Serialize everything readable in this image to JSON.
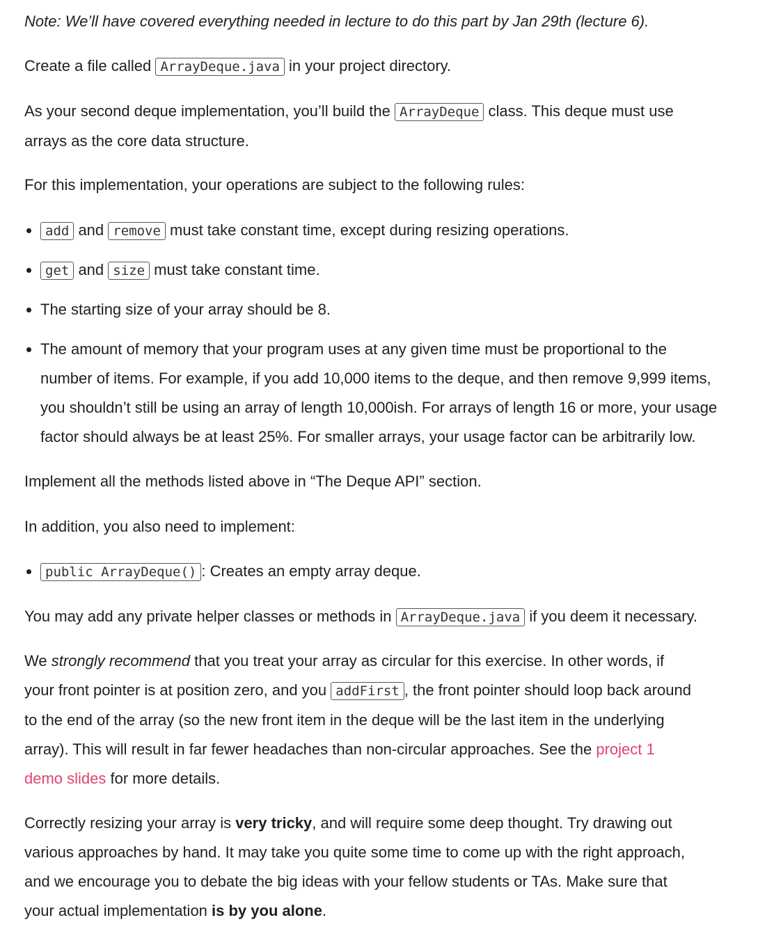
{
  "note": "Note: We’ll have covered everything needed in lecture to do this part by Jan 29th (lecture 6).",
  "p1": {
    "before": "Create a file called ",
    "code": "ArrayDeque.java",
    "after": " in your project directory."
  },
  "p2": {
    "before": "As your second deque implementation, you’ll build the ",
    "code": "ArrayDeque",
    "after": " class. This deque must use",
    "line2": "arrays as the core data structure."
  },
  "p3": "For this implementation, your operations are subject to the following rules:",
  "rules": {
    "r1": {
      "code1": "add",
      "mid": " and ",
      "code2": "remove",
      "after": " must take constant time, except during resizing operations."
    },
    "r2": {
      "code1": "get",
      "mid": " and ",
      "code2": "size",
      "after": " must take constant time."
    },
    "r3": "The starting size of your array should be 8.",
    "r4": {
      "line1": "The amount of memory that your program uses at any given time must be proportional to the",
      "line2": "number of items. For example, if you add 10,000 items to the deque, and then remove 9,999 items,",
      "line3": "you shouldn’t still be using an array of length 10,000ish. For arrays of length 16 or more, your usage",
      "line4": "factor should always be at least 25%. For smaller arrays, your usage factor can be arbitrarily low."
    }
  },
  "p4": "Implement all the methods listed above in “The Deque API” section.",
  "p5": "In addition, you also need to implement:",
  "constructor": {
    "code": "public ArrayDeque()",
    "after": ": Creates an empty array deque."
  },
  "p6": {
    "before": "You may add any private helper classes or methods in ",
    "code": "ArrayDeque.java",
    "after": " if you deem it necessary."
  },
  "p7": {
    "l1_before": "We ",
    "l1_em": "strongly recommend",
    "l1_after": " that you treat your array as circular for this exercise. In other words, if",
    "l2_before": "your front pointer is at position zero, and you ",
    "l2_code": "addFirst",
    "l2_after": ", the front pointer should loop back around",
    "l3": "to the end of the array (so the new front item in the deque will be the last item in the underlying",
    "l4_before": "array). This will result in far fewer headaches than non-circular approaches. See the ",
    "l4_link": "project 1",
    "l5_link": "demo slides",
    "l5_after": " for more details."
  },
  "p8": {
    "l1_before": "Correctly resizing your array is ",
    "l1_strong": "very tricky",
    "l1_after": ", and will require some deep thought. Try drawing out",
    "l2": "various approaches by hand. It may take you quite some time to come up with the right approach,",
    "l3": "and we encourage you to debate the big ideas with your fellow students or TAs. Make sure that",
    "l4_before": "your actual implementation ",
    "l4_strong": "is by you alone",
    "l4_after": "."
  }
}
